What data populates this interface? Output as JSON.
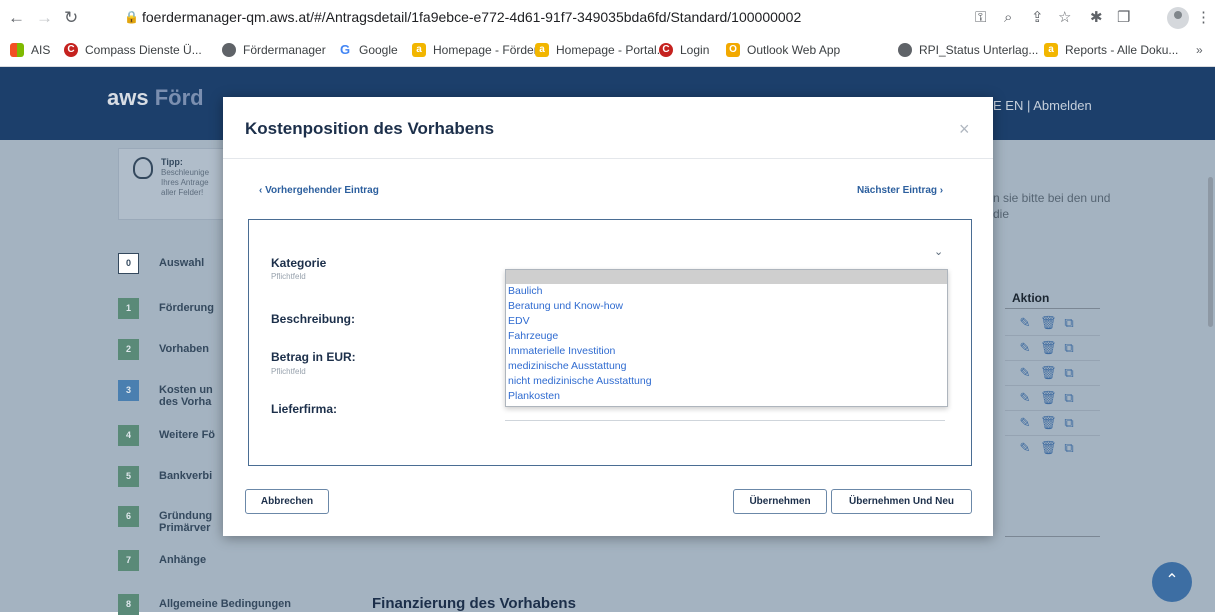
{
  "browser": {
    "url": "foerdermanager-qm.aws.at/#/Antragsdetail/1fa9ebce-e772-4d61-91f7-349035bda6fd/Standard/100000002",
    "bookmarks": [
      {
        "label": "AIS",
        "icon": "ms-icon"
      },
      {
        "label": "Compass Dienste Ü...",
        "icon": "compass-icon"
      },
      {
        "label": "Fördermanager",
        "icon": "globe-icon"
      },
      {
        "label": "Google",
        "icon": "google-icon"
      },
      {
        "label": "Homepage - Förder...",
        "icon": "homepage-icon"
      },
      {
        "label": "Homepage - Portal...",
        "icon": "homepage-icon"
      },
      {
        "label": "Login",
        "icon": "compass-icon"
      },
      {
        "label": "Outlook Web App",
        "icon": "outlook-icon"
      },
      {
        "label": "RPI_Status Unterlag...",
        "icon": "globe-icon"
      },
      {
        "label": "Reports - Alle Doku...",
        "icon": "homepage-icon"
      }
    ],
    "overflow": "»"
  },
  "header": {
    "logo_main": "aws",
    "logo_accent": "Förd",
    "right": "E EN | Abmelden"
  },
  "tip": {
    "title": "Tipp:",
    "text": "Beschleunige Ihres Antrage aller Felder!"
  },
  "right_hint": "n sie bitte bei den und die",
  "steps": [
    {
      "num": "0",
      "label": "Auswahl"
    },
    {
      "num": "1",
      "label": "Förderung"
    },
    {
      "num": "2",
      "label": "Vorhaben"
    },
    {
      "num": "3",
      "label": "Kosten un des Vorha"
    },
    {
      "num": "4",
      "label": "Weitere Fö"
    },
    {
      "num": "5",
      "label": "Bankverbi"
    },
    {
      "num": "6",
      "label": "Gründung Primärver"
    },
    {
      "num": "7",
      "label": "Anhänge"
    },
    {
      "num": "8",
      "label": "Allgemeine Bedingungen"
    }
  ],
  "table": {
    "aktion_header": "Aktion",
    "row_count": 6
  },
  "finanzierung_title": "Finanzierung des Vorhabens",
  "modal": {
    "title": "Kostenposition des Vorhabens",
    "close": "×",
    "prev": "‹ Vorhergehender Eintrag",
    "next": "Nächster Eintrag ›",
    "fields": {
      "kategorie": "Kategorie",
      "kategorie_hint": "Pflichtfeld",
      "beschreibung": "Beschreibung:",
      "betrag": "Betrag in EUR:",
      "betrag_hint": "Pflichtfeld",
      "lieferfirma": "Lieferfirma:"
    },
    "dropdown_options": [
      "",
      "Baulich",
      "Beratung und Know-how",
      "EDV",
      "Fahrzeuge",
      "Immaterielle Investition",
      "medizinische Ausstattung",
      "nicht medizinische Ausstattung",
      "Plankosten"
    ],
    "buttons": {
      "cancel": "Abbrechen",
      "apply": "Übernehmen",
      "apply_new": "Übernehmen Und Neu"
    }
  }
}
